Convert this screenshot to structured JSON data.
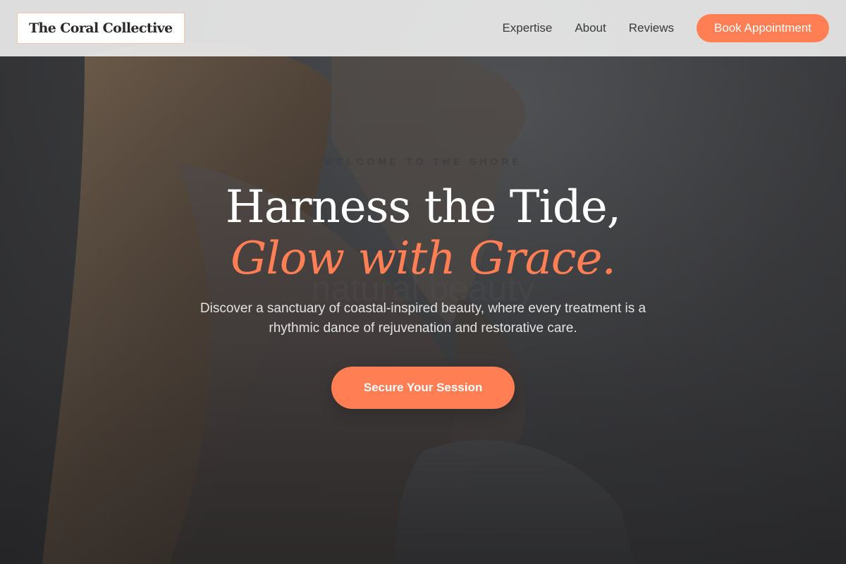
{
  "header": {
    "logo_text": "The Coral Collective",
    "nav": [
      {
        "label": "Expertise"
      },
      {
        "label": "About"
      },
      {
        "label": "Reviews"
      }
    ],
    "cta_label": "Book Appointment"
  },
  "hero": {
    "eyebrow": "Welcome to the shore",
    "title_line1": "Harness the Tide,",
    "title_line2": "Glow with Grace.",
    "background_ghost_text": "natural beauty",
    "subtitle": "Discover a sanctuary of coastal-inspired beauty, where every treatment is a rhythmic dance of rejuvenation and restorative care.",
    "cta_label": "Secure Your Session"
  },
  "colors": {
    "accent": "#ff7e54",
    "header_bg": "#ececec",
    "hero_bg": "#3f4043",
    "title": "#ffffff"
  }
}
